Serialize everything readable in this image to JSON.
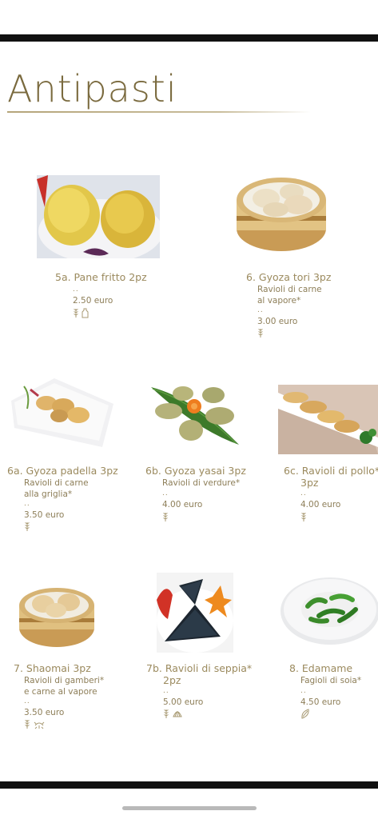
{
  "page": {
    "title": "Antipasti"
  },
  "items": [
    {
      "name": "5a. Pane fritto 2pz",
      "desc": [],
      "dots": "..",
      "price": "2.50 euro",
      "allergens": [
        "wheat-icon",
        "milk-bottle-icon"
      ]
    },
    {
      "name": "6. Gyoza tori 3pz",
      "desc": [
        "Ravioli di carne",
        "al vapore*"
      ],
      "dots": "..",
      "price": "3.00 euro",
      "allergens": [
        "wheat-icon"
      ]
    },
    {
      "name": "6a. Gyoza padella 3pz",
      "desc": [
        "Ravioli di carne",
        "alla griglia*"
      ],
      "dots": "..",
      "price": "3.50 euro",
      "allergens": [
        "wheat-icon"
      ]
    },
    {
      "name": "6b. Gyoza yasai 3pz",
      "desc": [
        "Ravioli di verdure*"
      ],
      "dots": "..",
      "price": "4.00 euro",
      "allergens": [
        "wheat-icon"
      ]
    },
    {
      "name": "6c. Ravioli di pollo*",
      "name2": "3pz",
      "desc": [],
      "dots": "..",
      "price": "4.00 euro",
      "allergens": [
        "wheat-icon"
      ]
    },
    {
      "name": "7. Shaomai 3pz",
      "desc": [
        "Ravioli di gamberi*",
        "e carne al vapore"
      ],
      "dots": "..",
      "price": "3.50 euro",
      "allergens": [
        "wheat-icon",
        "crustacean-icon"
      ]
    },
    {
      "name": "7b. Ravioli di seppia*",
      "name2": "2pz",
      "desc": [],
      "dots": "..",
      "price": "5.00 euro",
      "allergens": [
        "wheat-icon",
        "shellfish-icon"
      ]
    },
    {
      "name": "8. Edamame",
      "desc": [
        "Fagioli di soia*"
      ],
      "dots": "..",
      "price": "4.50 euro",
      "allergens": [
        "soy-pod-icon"
      ]
    }
  ]
}
